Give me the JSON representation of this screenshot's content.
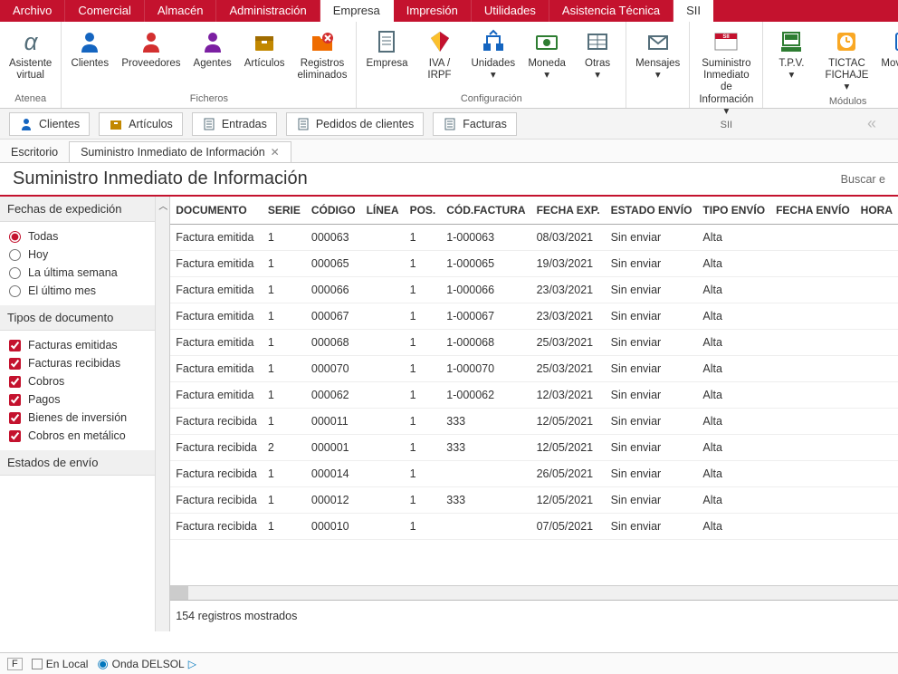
{
  "menubar": [
    {
      "label": "Archivo"
    },
    {
      "label": "Comercial"
    },
    {
      "label": "Almacén"
    },
    {
      "label": "Administración"
    },
    {
      "label": "Empresa",
      "active": true
    },
    {
      "label": "Impresión"
    },
    {
      "label": "Utilidades"
    },
    {
      "label": "Asistencia Técnica"
    },
    {
      "label": "SII",
      "sii": true
    }
  ],
  "ribbon": {
    "groups": [
      {
        "label": "Atenea",
        "buttons": [
          {
            "label": "Asistente\nvirtual",
            "icon": "alpha",
            "color": "#546e7a"
          }
        ]
      },
      {
        "label": "Ficheros",
        "buttons": [
          {
            "label": "Clientes",
            "icon": "person",
            "color": "#1565c0"
          },
          {
            "label": "Proveedores",
            "icon": "person",
            "color": "#d32f2f"
          },
          {
            "label": "Agentes",
            "icon": "person",
            "color": "#7b1fa2"
          },
          {
            "label": "Artículos",
            "icon": "box",
            "color": "#c28800"
          },
          {
            "label": "Registros\neliminados",
            "icon": "folder-x",
            "color": "#ef6c00"
          }
        ]
      },
      {
        "label": "Configuración",
        "buttons": [
          {
            "label": "Empresa",
            "icon": "doc",
            "color": "#546e7a"
          },
          {
            "label": "IVA /\nIRPF",
            "icon": "percent",
            "color": "#c4122e"
          },
          {
            "label": "Unidades\n▾",
            "icon": "units",
            "color": "#1565c0"
          },
          {
            "label": "Moneda\n▾",
            "icon": "money",
            "color": "#2e7d32"
          },
          {
            "label": "Otras\n▾",
            "icon": "table",
            "color": "#546e7a"
          }
        ]
      },
      {
        "label": "",
        "buttons": [
          {
            "label": "Mensajes\n▾",
            "icon": "mail",
            "color": "#546e7a"
          }
        ]
      },
      {
        "label": "SII",
        "buttons": [
          {
            "label": "Suministro Inmediato\nde Información ▾",
            "icon": "sii",
            "color": "#c4122e"
          }
        ]
      },
      {
        "label": "Módulos",
        "buttons": [
          {
            "label": "T.P.V.\n▾",
            "icon": "tpv",
            "color": "#2e7d32"
          },
          {
            "label": "TICTAC\nFICHAJE ▾",
            "icon": "tictac",
            "color": "#f9a825"
          },
          {
            "label": "Movilidad\n▾",
            "icon": "mobile",
            "color": "#1565c0"
          }
        ]
      }
    ]
  },
  "quickbar": [
    {
      "label": "Clientes",
      "icon": "person",
      "color": "#1565c0"
    },
    {
      "label": "Artículos",
      "icon": "box",
      "color": "#c28800"
    },
    {
      "label": "Entradas",
      "icon": "doc",
      "color": "#546e7a"
    },
    {
      "label": "Pedidos de clientes",
      "icon": "doc",
      "color": "#546e7a"
    },
    {
      "label": "Facturas",
      "icon": "doc",
      "color": "#546e7a"
    }
  ],
  "workspace_tabs": [
    {
      "label": "Escritorio",
      "plain": true
    },
    {
      "label": "Suministro Inmediato de Información",
      "closable": true
    }
  ],
  "page": {
    "title": "Suministro Inmediato de Información",
    "search_placeholder": "Buscar e"
  },
  "filters": {
    "fechas": {
      "title": "Fechas de expedición",
      "options": [
        "Todas",
        "Hoy",
        "La última semana",
        "El último mes"
      ],
      "selected": 0
    },
    "tipos": {
      "title": "Tipos de documento",
      "options": [
        "Facturas emitidas",
        "Facturas recibidas",
        "Cobros",
        "Pagos",
        "Bienes de inversión",
        "Cobros en metálico"
      ]
    },
    "estados": {
      "title": "Estados de envío"
    }
  },
  "table": {
    "columns": [
      "DOCUMENTO",
      "SERIE",
      "CÓDIGO",
      "LÍNEA",
      "POS.",
      "CÓD.FACTURA",
      "FECHA EXP.",
      "ESTADO ENVÍO",
      "TIPO ENVÍO",
      "FECHA ENVÍO",
      "HORA"
    ],
    "rows": [
      [
        "Factura emitida",
        "1",
        "000063",
        "",
        "1",
        "1-000063",
        "08/03/2021",
        "Sin enviar",
        "Alta",
        "",
        ""
      ],
      [
        "Factura emitida",
        "1",
        "000065",
        "",
        "1",
        "1-000065",
        "19/03/2021",
        "Sin enviar",
        "Alta",
        "",
        ""
      ],
      [
        "Factura emitida",
        "1",
        "000066",
        "",
        "1",
        "1-000066",
        "23/03/2021",
        "Sin enviar",
        "Alta",
        "",
        ""
      ],
      [
        "Factura emitida",
        "1",
        "000067",
        "",
        "1",
        "1-000067",
        "23/03/2021",
        "Sin enviar",
        "Alta",
        "",
        ""
      ],
      [
        "Factura emitida",
        "1",
        "000068",
        "",
        "1",
        "1-000068",
        "25/03/2021",
        "Sin enviar",
        "Alta",
        "",
        ""
      ],
      [
        "Factura emitida",
        "1",
        "000070",
        "",
        "1",
        "1-000070",
        "25/03/2021",
        "Sin enviar",
        "Alta",
        "",
        ""
      ],
      [
        "Factura emitida",
        "1",
        "000062",
        "",
        "1",
        "1-000062",
        "12/03/2021",
        "Sin enviar",
        "Alta",
        "",
        ""
      ],
      [
        "Factura recibida",
        "1",
        "000011",
        "",
        "1",
        "333",
        "12/05/2021",
        "Sin enviar",
        "Alta",
        "",
        ""
      ],
      [
        "Factura recibida",
        "2",
        "000001",
        "",
        "1",
        "333",
        "12/05/2021",
        "Sin enviar",
        "Alta",
        "",
        ""
      ],
      [
        "Factura recibida",
        "1",
        "000014",
        "",
        "1",
        "",
        "26/05/2021",
        "Sin enviar",
        "Alta",
        "",
        ""
      ],
      [
        "Factura recibida",
        "1",
        "000012",
        "",
        "1",
        "333",
        "12/05/2021",
        "Sin enviar",
        "Alta",
        "",
        ""
      ],
      [
        "Factura recibida",
        "1",
        "000010",
        "",
        "1",
        "",
        "07/05/2021",
        "Sin enviar",
        "Alta",
        "",
        ""
      ]
    ],
    "footer": "154 registros mostrados"
  },
  "statusbar": {
    "f": "F",
    "local": "En Local",
    "brand": "Onda DELSOL"
  }
}
